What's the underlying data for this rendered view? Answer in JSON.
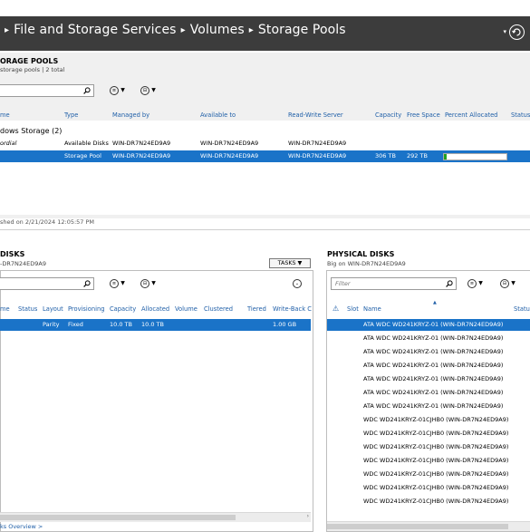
{
  "breadcrumb": {
    "items": [
      "File and Storage Services",
      "Volumes",
      "Storage Pools"
    ]
  },
  "storage_pools": {
    "title": "ORAGE POOLS",
    "subtitle": "storage pools | 2 total",
    "columns": [
      "me",
      "Type",
      "Managed by",
      "Available to",
      "Read-Write Server",
      "Capacity",
      "Free Space",
      "Percent Allocated",
      "Status"
    ],
    "group_label": "dows Storage (2)",
    "rows": [
      {
        "name": "ordial",
        "type": "Available Disks",
        "managed_by": "WIN-DR7N24ED9A9",
        "available_to": "WIN-DR7N24ED9A9",
        "rw_server": "WIN-DR7N24ED9A9",
        "capacity": "",
        "free_space": "",
        "percent_allocated": null
      },
      {
        "name": "",
        "type": "Storage Pool",
        "managed_by": "WIN-DR7N24ED9A9",
        "available_to": "WIN-DR7N24ED9A9",
        "rw_server": "WIN-DR7N24ED9A9",
        "capacity": "306 TB",
        "free_space": "292 TB",
        "percent_allocated": 0.04
      }
    ],
    "refreshed": "shed on 2/21/2024 12:05:57 PM"
  },
  "virtual_disks": {
    "title": "DISKS",
    "subtitle": "-DR7N24ED9A9",
    "tasks_label": "TASKS",
    "columns": [
      "me",
      "Status",
      "Layout",
      "Provisioning",
      "Capacity",
      "Allocated",
      "Volume",
      "Clustered",
      "Tiered",
      "Write-Back C"
    ],
    "rows": [
      {
        "layout": "Parity",
        "provisioning": "Fixed",
        "capacity": "10.0 TB",
        "allocated": "10.0 TB",
        "write_back": "1.00 GB"
      }
    ],
    "footer_link": "ks Overview >"
  },
  "physical_disks": {
    "title": "PHYSICAL DISKS",
    "subtitle": "Big on WIN-DR7N24ED9A9",
    "filter_placeholder": "Filter",
    "columns": [
      "Slot",
      "Name",
      "Statu"
    ],
    "rows": [
      "ATA WDC WD241KRYZ-01 (WIN-DR7N24ED9A9)",
      "ATA WDC WD241KRYZ-01 (WIN-DR7N24ED9A9)",
      "ATA WDC WD241KRYZ-01 (WIN-DR7N24ED9A9)",
      "ATA WDC WD241KRYZ-01 (WIN-DR7N24ED9A9)",
      "ATA WDC WD241KRYZ-01 (WIN-DR7N24ED9A9)",
      "ATA WDC WD241KRYZ-01 (WIN-DR7N24ED9A9)",
      "ATA WDC WD241KRYZ-01 (WIN-DR7N24ED9A9)",
      "WDC WD241KRYZ-01CJHB0 (WIN-DR7N24ED9A9)",
      "WDC WD241KRYZ-01CJHB0 (WIN-DR7N24ED9A9)",
      "WDC WD241KRYZ-01CJHB0 (WIN-DR7N24ED9A9)",
      "WDC WD241KRYZ-01CJHB0 (WIN-DR7N24ED9A9)",
      "WDC WD241KRYZ-01CJHB0 (WIN-DR7N24ED9A9)",
      "WDC WD241KRYZ-01CJHB0 (WIN-DR7N24ED9A9)",
      "WDC WD241KRYZ-01CJHB0 (WIN-DR7N24ED9A9)"
    ],
    "selected_index": 0
  },
  "colors": {
    "title_bar": "#3c3c3c",
    "selection": "#1a73c8",
    "column_header": "#1f5fa8",
    "progress_fill": "#21a121"
  }
}
